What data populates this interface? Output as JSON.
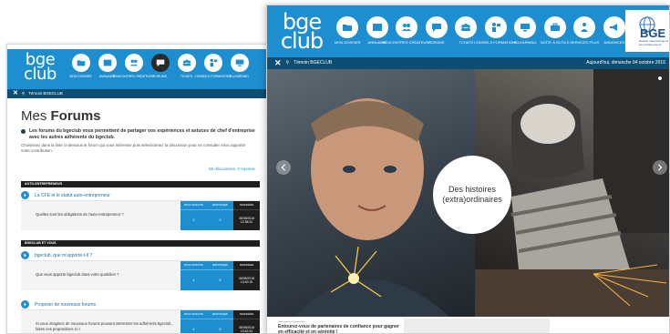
{
  "left_window": {
    "logo": {
      "line1": "bge",
      "line2": "club"
    },
    "nav": [
      {
        "icon": "folder-icon",
        "label": "Mon dossier",
        "active": false
      },
      {
        "icon": "book-icon",
        "label": "Annuaire",
        "active": false
      },
      {
        "icon": "people-icon",
        "label": "Rencontres créateurs",
        "active": false
      },
      {
        "icon": "chat-icon",
        "label": "Forums",
        "active": true
      },
      {
        "icon": "group-icon",
        "label": "Tchats",
        "active": false
      },
      {
        "icon": "teacher-icon",
        "label": "Conseils formations",
        "active": false
      },
      {
        "icon": "elearning-icon",
        "label": "E-learning",
        "active": false
      }
    ],
    "bar_user": "Témoin BGECLUB",
    "title_prefix": "Mes",
    "title_main": "Forums",
    "intro": "Les forums du bgeclub vous permettent de partager vos expériences et astuces de chef d'entreprise avec les autres adhérents du bgeclub.",
    "description": "Choisissez dans la liste ci-dessous le forum qui vous intéresse puis sélectionnez la discussion pour en consulter et/ou apporter votre contribution.",
    "counts": "55 discussions, 0 réponse",
    "sections": [
      {
        "name": "Auto-entrepreneur",
        "topic": "La CFE et le statut auto-entrepreneur",
        "question": "Quelles sont les obligations de l'auto-entrepreneur ?",
        "discussions": "2",
        "responses": "2",
        "last_date": "05/05/2015",
        "last_time": "12:38:02"
      },
      {
        "name": "bgeclub et vous",
        "topic": "bgeclub, que m'apporte-t-il ?",
        "question": "Que vous apporte bgeclub dans votre quotidien ?",
        "discussions": "4",
        "responses": "5",
        "last_date": "05/05/2015",
        "last_time": "13:40:15"
      },
      {
        "name": "",
        "topic": "Proposer de nouveaux forums",
        "question": "Si vous imaginez de nouveaux forums pouvant intéresser les adhérents bgeclub, faites vos propositions ici !",
        "discussions": "4",
        "responses": "5",
        "last_date": "05/05/2015",
        "last_time": "13:42:24"
      }
    ],
    "stat_headers": {
      "discussions": "Discussions",
      "responses": "Réponses",
      "last": "Dernière"
    }
  },
  "right_window": {
    "logo": {
      "line1": "bge",
      "line2": "club"
    },
    "nav": [
      {
        "icon": "folder-icon",
        "label": "Mon dossier"
      },
      {
        "icon": "book-icon",
        "label": "Annuaire"
      },
      {
        "icon": "people-icon",
        "label": "Rencontres créateurs"
      },
      {
        "icon": "chat-icon",
        "label": "Forums"
      },
      {
        "icon": "group-icon",
        "label": "Tchats"
      },
      {
        "icon": "teacher-icon",
        "label": "Conseils formations"
      },
      {
        "icon": "elearning-icon",
        "label": "E-learning"
      },
      {
        "icon": "toolbox-icon",
        "label": "Boîte à outils"
      },
      {
        "icon": "services-icon",
        "label": "Services plus"
      },
      {
        "icon": "announce-icon",
        "label": "Annonces"
      }
    ],
    "brand": {
      "name": "BGE",
      "tagline": "Réseau national d'appui aux entrepreneurs"
    },
    "bar_user": "Témoin BGECLUB",
    "date": "Aujourd'hui, dimanche 04 octobre 2015",
    "hero_caption_line1": "Des histoires",
    "hero_caption_line2": "(extra)ordinaires",
    "tagline": "Entourez-vous de partenaires de confiance pour gagner en efficacité et en sérénité !"
  }
}
